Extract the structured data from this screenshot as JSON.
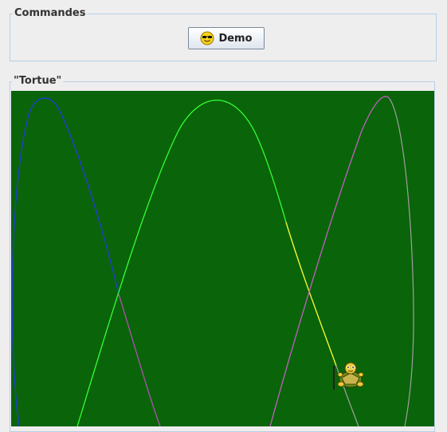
{
  "commands": {
    "legend": "Commandes",
    "demo_label": "Demo",
    "demo_icon": "smiley-sunglasses-icon"
  },
  "tortue": {
    "legend": "\"Tortue\"",
    "background_color": "#0a640a",
    "turtle_icon": "turtle-icon",
    "curve_colors": [
      "#1f3fd0",
      "#33ff33",
      "#ffff33",
      "#c060c0",
      "#a0a0a0"
    ]
  }
}
